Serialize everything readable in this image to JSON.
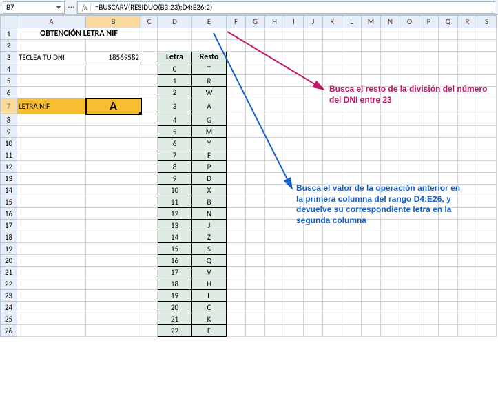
{
  "name_box": "B7",
  "formula": "=BUSCARV(RESIDUO(B3;23);D4:E26;2)",
  "fx_label": "fx",
  "columns": [
    "A",
    "B",
    "C",
    "D",
    "E",
    "F",
    "G",
    "H",
    "I",
    "J",
    "K",
    "L",
    "M",
    "N",
    "O",
    "P",
    "Q",
    "R",
    "S"
  ],
  "rows": [
    "1",
    "2",
    "3",
    "4",
    "5",
    "6",
    "7",
    "8",
    "9",
    "10",
    "11",
    "12",
    "13",
    "14",
    "15",
    "16",
    "17",
    "18",
    "19",
    "20",
    "21",
    "22",
    "23",
    "24",
    "25",
    "26"
  ],
  "cells": {
    "title": "OBTENCIÓN LETRA NIF",
    "teclea_label": "TECLEA TU DNI",
    "dni_value": "18569582",
    "letranif_label": "LETRA NIF",
    "letranif_value": "A",
    "letra_header": "Letra",
    "resto_header": "Resto",
    "table": [
      {
        "n": "0",
        "l": "T"
      },
      {
        "n": "1",
        "l": "R"
      },
      {
        "n": "2",
        "l": "W"
      },
      {
        "n": "3",
        "l": "A"
      },
      {
        "n": "4",
        "l": "G"
      },
      {
        "n": "5",
        "l": "M"
      },
      {
        "n": "6",
        "l": "Y"
      },
      {
        "n": "7",
        "l": "F"
      },
      {
        "n": "8",
        "l": "P"
      },
      {
        "n": "9",
        "l": "D"
      },
      {
        "n": "10",
        "l": "X"
      },
      {
        "n": "11",
        "l": "B"
      },
      {
        "n": "12",
        "l": "N"
      },
      {
        "n": "13",
        "l": "J"
      },
      {
        "n": "14",
        "l": "Z"
      },
      {
        "n": "15",
        "l": "S"
      },
      {
        "n": "16",
        "l": "Q"
      },
      {
        "n": "17",
        "l": "V"
      },
      {
        "n": "18",
        "l": "H"
      },
      {
        "n": "19",
        "l": "L"
      },
      {
        "n": "20",
        "l": "C"
      },
      {
        "n": "21",
        "l": "K"
      },
      {
        "n": "22",
        "l": "E"
      }
    ]
  },
  "annotations": {
    "magenta": "Busca el resto de la división del número del DNI entre 23",
    "blue": "Busca el valor de la operación anterior en la primera columna del rango D4:E26, y devuelve su correspondiente letra en la segunda columna"
  },
  "selected_col": "B",
  "selected_row": "7"
}
